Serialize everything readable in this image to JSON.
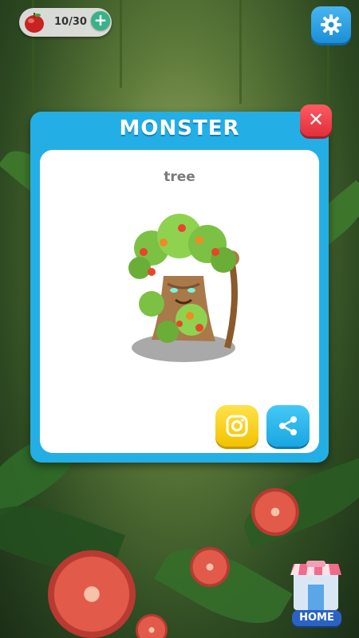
{
  "hud": {
    "apple_icon": "apple-icon",
    "apple_count": "10/30",
    "add_icon": "plus-icon",
    "add_symbol": "+",
    "settings_icon": "gear-icon"
  },
  "modal": {
    "title": "MONSTER",
    "close_symbol": "✕",
    "monster_name": "tree",
    "monster_image": "tree-monster-illustration",
    "instagram_icon": "instagram-icon",
    "share_icon": "share-icon"
  },
  "home": {
    "label": "HOME",
    "icon": "shop-home-icon"
  },
  "colors": {
    "modal_blue": "#24aee6",
    "close_red": "#e02f3a",
    "instagram_yellow": "#f2c200",
    "share_blue": "#19a6e2",
    "home_blue": "#2b63c4"
  }
}
